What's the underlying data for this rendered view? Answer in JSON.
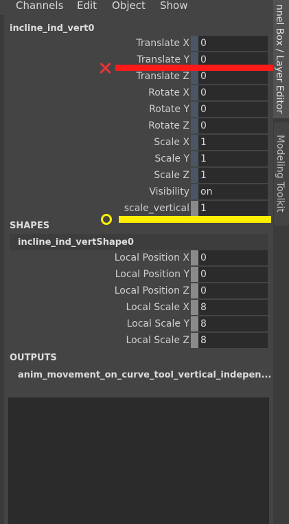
{
  "menubar": [
    "Channels",
    "Edit",
    "Object",
    "Show"
  ],
  "node_title": "incline_ind_vert0",
  "transform_attrs": [
    {
      "label": "Translate X",
      "value": "0",
      "key": "blue"
    },
    {
      "label": "Translate Y",
      "value": "0",
      "key": "blue"
    },
    {
      "label": "Translate Z",
      "value": "0",
      "key": "blue"
    },
    {
      "label": "Rotate X",
      "value": "0",
      "key": "blue"
    },
    {
      "label": "Rotate Y",
      "value": "0",
      "key": "blue"
    },
    {
      "label": "Rotate Z",
      "value": "0",
      "key": "blue"
    },
    {
      "label": "Scale X",
      "value": "1",
      "key": "blue"
    },
    {
      "label": "Scale Y",
      "value": "1",
      "key": "blue"
    },
    {
      "label": "Scale Z",
      "value": "1",
      "key": "blue"
    },
    {
      "label": "Visibility",
      "value": "on",
      "key": "blue"
    },
    {
      "label": "scale_vertical",
      "value": "1",
      "key": "grey"
    }
  ],
  "shapes_title": "SHAPES",
  "shape_node": "incline_ind_vertShape0",
  "shape_attrs": [
    {
      "label": "Local Position X",
      "value": "0"
    },
    {
      "label": "Local Position Y",
      "value": "0"
    },
    {
      "label": "Local Position Z",
      "value": "0"
    },
    {
      "label": "Local Scale X",
      "value": "8"
    },
    {
      "label": "Local Scale Y",
      "value": "8"
    },
    {
      "label": "Local Scale Z",
      "value": "8"
    }
  ],
  "outputs_title": "OUTPUTS",
  "outputs_node": "anim_movement_on_curve_tool_vertical_indepen...",
  "right_tabs": {
    "channel_box": "nnel Box / Layer Editor",
    "modeling_toolkit": "Modeling Toolkit"
  },
  "annotation_colors": {
    "cross": "#e8353a",
    "circle": "#ffee00"
  }
}
